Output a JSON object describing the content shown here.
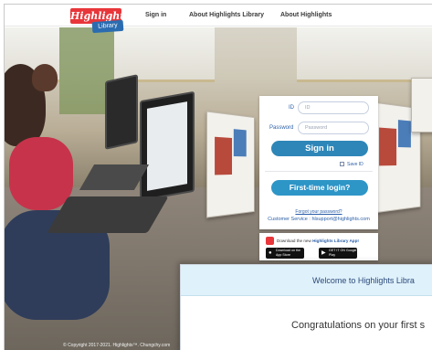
{
  "brand": {
    "logo_main": "Highlights",
    "logo_sub": "Library"
  },
  "nav": {
    "sign_in": "Sign in",
    "about_library": "About Highlights Library",
    "about": "About Highlights"
  },
  "login": {
    "id_label": "ID",
    "id_placeholder": "ID",
    "password_label": "Password",
    "password_placeholder": "Password",
    "sign_in_button": "Sign in",
    "save_id": "Save ID",
    "first_time_button": "First-time login?",
    "forgot_password": "Forgot your password?",
    "customer_service": "Customer Service : hlsupport@highlights.com"
  },
  "app_promo": {
    "text_prefix": "Download the new ",
    "text_bold": "Highlights Library App!",
    "app_store": "Download on the App Store",
    "google_play": "GET IT ON Google Play"
  },
  "footer": {
    "copyright": "© Copyright 2017-2021. Highlights™. Chungchy.com"
  },
  "modal": {
    "title": "Welcome to Highlights Libra",
    "body": "Congratulations on your first s"
  },
  "colors": {
    "primary_button": "#2e86b8",
    "brand_red": "#e8363a",
    "link_blue": "#2b5fa8",
    "modal_header": "#dff1fb"
  }
}
